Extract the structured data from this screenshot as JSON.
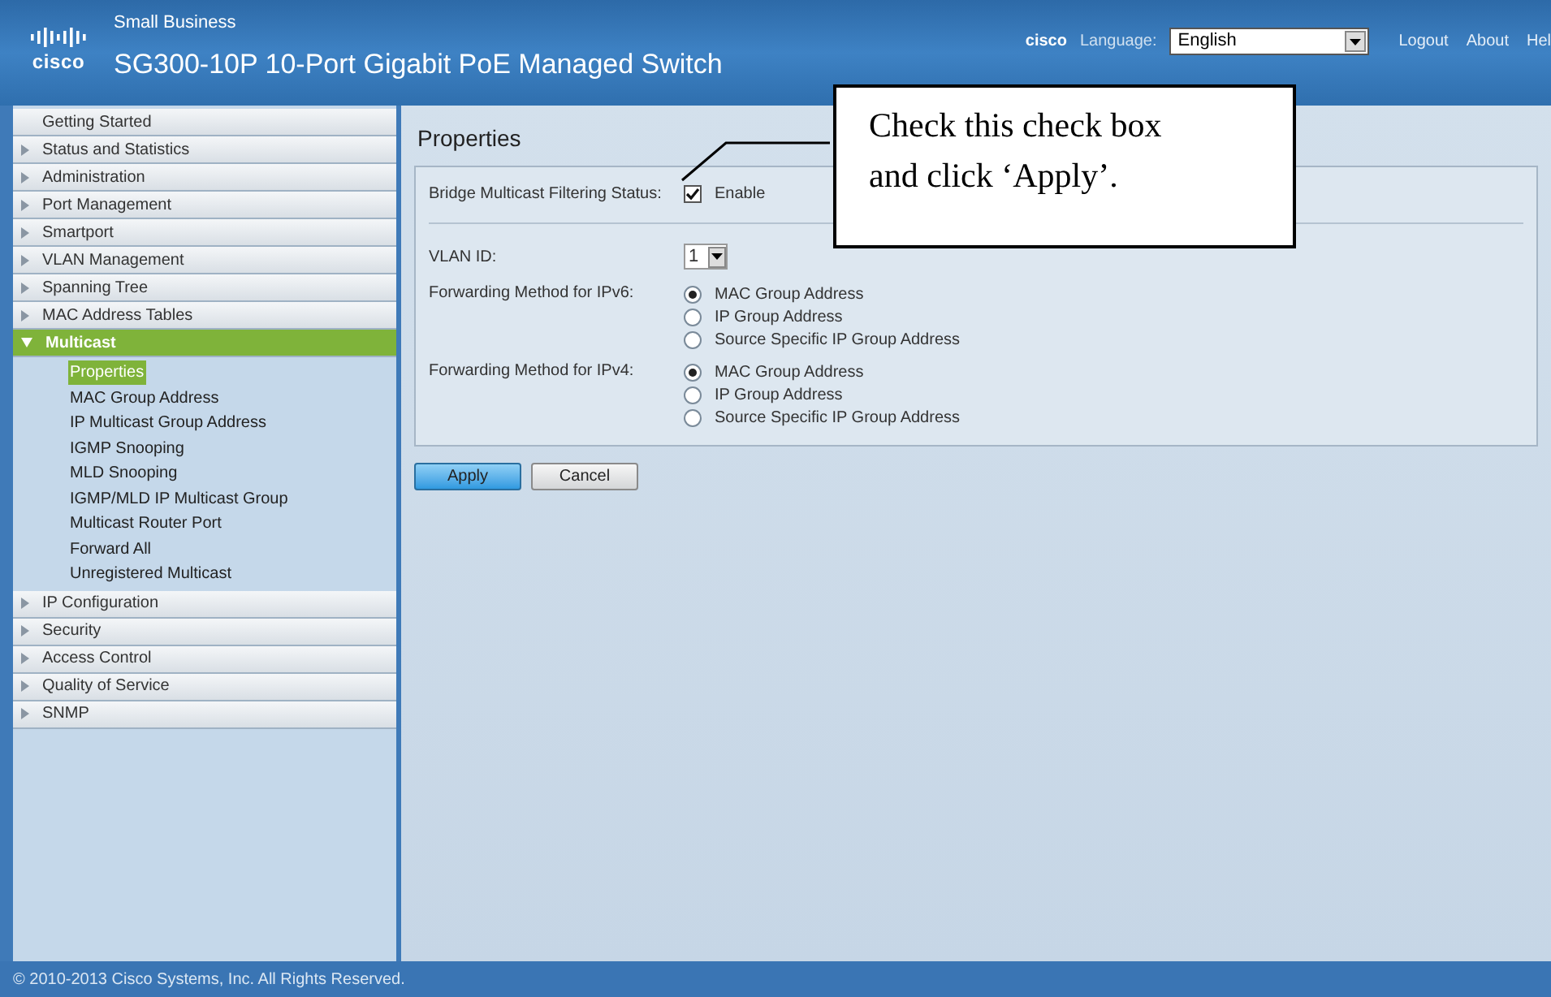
{
  "header": {
    "brand": "cisco",
    "subtitle": "Small Business",
    "title": "SG300-10P 10-Port Gigabit PoE Managed Switch",
    "user": "cisco",
    "language_label": "Language:",
    "language": "English",
    "links": [
      "Logout",
      "About",
      "Hel"
    ]
  },
  "sidebar": {
    "items": [
      {
        "label": "Getting Started",
        "expandable": false,
        "expanded": false,
        "selected": false
      },
      {
        "label": "Status and Statistics",
        "expandable": true,
        "expanded": false,
        "selected": false
      },
      {
        "label": "Administration",
        "expandable": true,
        "expanded": false,
        "selected": false
      },
      {
        "label": "Port Management",
        "expandable": true,
        "expanded": false,
        "selected": false
      },
      {
        "label": "Smartport",
        "expandable": true,
        "expanded": false,
        "selected": false
      },
      {
        "label": "VLAN Management",
        "expandable": true,
        "expanded": false,
        "selected": false
      },
      {
        "label": "Spanning Tree",
        "expandable": true,
        "expanded": false,
        "selected": false
      },
      {
        "label": "MAC Address Tables",
        "expandable": true,
        "expanded": false,
        "selected": false
      },
      {
        "label": "Multicast",
        "expandable": true,
        "expanded": true,
        "selected": true,
        "children": [
          {
            "label": "Properties",
            "selected": true
          },
          {
            "label": "MAC Group Address",
            "selected": false
          },
          {
            "label": "IP Multicast Group Address",
            "selected": false
          },
          {
            "label": "IGMP Snooping",
            "selected": false
          },
          {
            "label": "MLD Snooping",
            "selected": false
          },
          {
            "label": "IGMP/MLD IP Multicast Group",
            "selected": false
          },
          {
            "label": "Multicast Router Port",
            "selected": false
          },
          {
            "label": "Forward All",
            "selected": false
          },
          {
            "label": "Unregistered Multicast",
            "selected": false
          }
        ]
      },
      {
        "label": "IP Configuration",
        "expandable": true,
        "expanded": false,
        "selected": false
      },
      {
        "label": "Security",
        "expandable": true,
        "expanded": false,
        "selected": false
      },
      {
        "label": "Access Control",
        "expandable": true,
        "expanded": false,
        "selected": false
      },
      {
        "label": "Quality of Service",
        "expandable": true,
        "expanded": false,
        "selected": false
      },
      {
        "label": "SNMP",
        "expandable": true,
        "expanded": false,
        "selected": false
      }
    ]
  },
  "page": {
    "title": "Properties",
    "filtering": {
      "label": "Bridge Multicast Filtering Status:",
      "option": "Enable",
      "checked": true
    },
    "vlan": {
      "label": "VLAN ID:",
      "value": "1"
    },
    "methods": [
      {
        "label": "Forwarding Method for IPv6:",
        "options": [
          {
            "label": "MAC Group Address",
            "selected": true
          },
          {
            "label": "IP Group Address",
            "selected": false
          },
          {
            "label": "Source Specific IP Group Address",
            "selected": false
          }
        ]
      },
      {
        "label": "Forwarding Method for IPv4:",
        "options": [
          {
            "label": "MAC Group Address",
            "selected": true
          },
          {
            "label": "IP Group Address",
            "selected": false
          },
          {
            "label": "Source Specific IP Group Address",
            "selected": false
          }
        ]
      }
    ],
    "buttons": [
      {
        "label": "Apply",
        "kind": "primary"
      },
      {
        "label": "Cancel",
        "kind": "secondary"
      }
    ]
  },
  "callout": {
    "text": "Check this check box and click ‘Apply’."
  },
  "footer": {
    "copyright": "© 2010-2013 Cisco Systems, Inc. All Rights Reserved."
  }
}
